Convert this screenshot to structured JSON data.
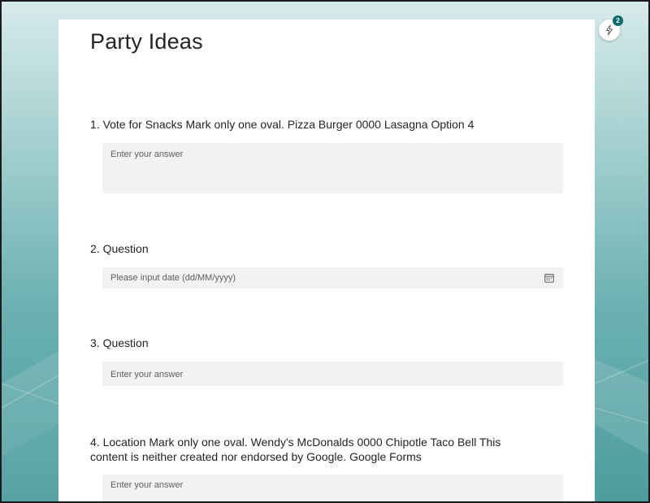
{
  "form": {
    "title": "Party Ideas"
  },
  "questions": [
    {
      "text": "1. Vote for Snacks Mark only one oval. Pizza Burger 0000 Lasagna Option 4",
      "placeholder": "Enter your answer"
    },
    {
      "text": "2. Question",
      "placeholder": "Please input date (dd/MM/yyyy)"
    },
    {
      "text": "3. Question",
      "placeholder": "Enter your answer"
    },
    {
      "text": "4. Location Mark only one oval. Wendy's McDonalds 0000 Chipotle Taco Bell This content is neither created nor endorsed by Google. Google Forms",
      "placeholder": "Enter your answer"
    }
  ],
  "badge": {
    "count": "2",
    "icon": "lightning-icon"
  },
  "colors": {
    "background_teal": "#5fa7a8",
    "card": "#ffffff",
    "input_bg": "#f3f2f1",
    "text": "#252423",
    "placeholder": "#605e5c",
    "badge": "#0f6b6b"
  }
}
